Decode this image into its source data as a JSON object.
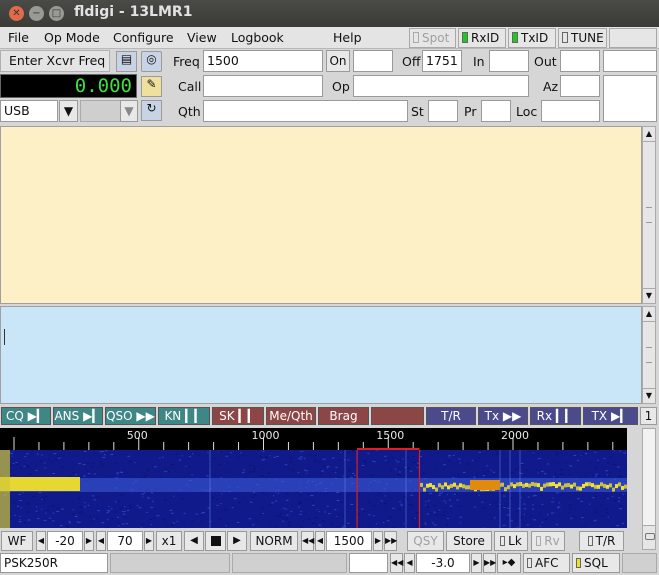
{
  "window": {
    "title": "fldigi - 13LMR1"
  },
  "menu": {
    "file": "File",
    "op_mode": "Op Mode",
    "configure": "Configure",
    "view": "View",
    "logbook": "Logbook",
    "help": "Help"
  },
  "toggles": {
    "spot": "Spot",
    "rxid": "RxID",
    "txid": "TxID",
    "tune": "TUNE"
  },
  "xcvr": {
    "enter_freq_label": "Enter Xcvr Freq",
    "freq_display": "0.000",
    "mode": "USB"
  },
  "qso": {
    "freq_label": "Freq",
    "freq_value": "1500",
    "on_label": "On",
    "on_value": "",
    "off_label": "Off",
    "off_value": "1751",
    "in_label": "In",
    "in_value": "",
    "out_label": "Out",
    "out_value": "",
    "call_label": "Call",
    "call_value": "",
    "op_label": "Op",
    "op_value": "",
    "az_label": "Az",
    "az_value": "",
    "qth_label": "Qth",
    "qth_value": "",
    "st_label": "St",
    "st_value": "",
    "pr_label": "Pr",
    "pr_value": "",
    "loc_label": "Loc",
    "loc_value": ""
  },
  "macros": [
    {
      "label": "CQ ▶▎",
      "color": "#3f8787"
    },
    {
      "label": "ANS ▶▎",
      "color": "#3f8787"
    },
    {
      "label": "QSO ▶▶",
      "color": "#3f8787"
    },
    {
      "label": "KN ▎▎",
      "color": "#3f8787"
    },
    {
      "label": "SK ▎▎",
      "color": "#8c4646"
    },
    {
      "label": "Me/Qth",
      "color": "#8c4646"
    },
    {
      "label": "Brag",
      "color": "#8c4646"
    },
    {
      "label": "",
      "color": "#8c4646"
    },
    {
      "label": "T/R",
      "color": "#4a4a8c"
    },
    {
      "label": "Tx ▶▶",
      "color": "#4a4a8c"
    },
    {
      "label": "Rx ▎▎",
      "color": "#4a4a8c"
    },
    {
      "label": "TX ▶▎",
      "color": "#4a4a8c"
    }
  ],
  "macro_page": "1",
  "scale": {
    "ticks": [
      "500",
      "1000",
      "1500",
      "2000"
    ]
  },
  "waterfall": {
    "cursor_hz": 1500,
    "bandwidth_hz": 250
  },
  "controls": {
    "wf": "WF",
    "ref_level": "-20",
    "range": "70",
    "zoom": "x1",
    "norm": "NORM",
    "carrier_freq": "1500",
    "qsy": "QSY",
    "store": "Store",
    "lk": "Lk",
    "rv": "Rv",
    "tr": "T/R"
  },
  "status": {
    "mode": "PSK250R",
    "metric": "-3.0",
    "afc": "AFC",
    "sql": "SQL"
  },
  "colors": {
    "rx_bg": "#fdf0c6",
    "tx_bg": "#c8e6f8",
    "freq_led": "#3ee03e",
    "led_green": "#21c821",
    "led_yellow": "#f0e21a"
  }
}
